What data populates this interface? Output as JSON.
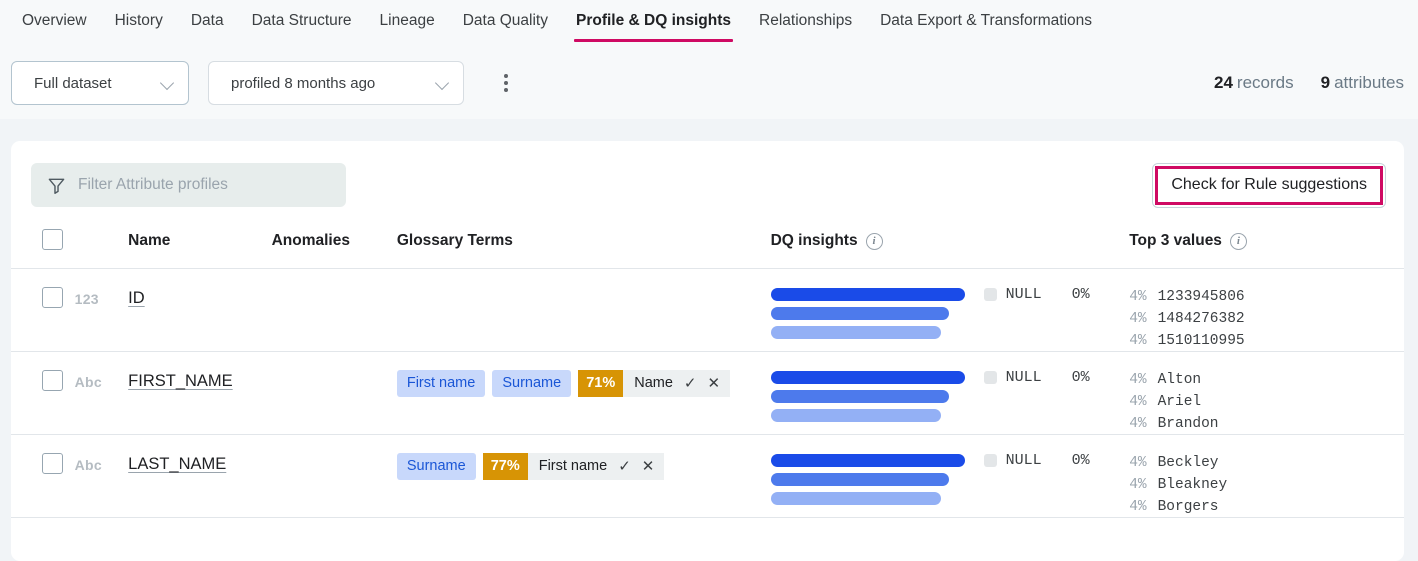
{
  "tabs": [
    {
      "label": "Overview",
      "active": false
    },
    {
      "label": "History",
      "active": false
    },
    {
      "label": "Data",
      "active": false
    },
    {
      "label": "Data Structure",
      "active": false
    },
    {
      "label": "Lineage",
      "active": false
    },
    {
      "label": "Data Quality",
      "active": false
    },
    {
      "label": "Profile & DQ insights",
      "active": true
    },
    {
      "label": "Relationships",
      "active": false
    },
    {
      "label": "Data Export & Transformations",
      "active": false
    }
  ],
  "toolbar": {
    "dataset_select": "Full dataset",
    "profiled_select": "profiled 8 months ago",
    "kebab_label": "more-options",
    "records_count": "24",
    "records_label": "records",
    "attributes_count": "9",
    "attributes_label": "attributes"
  },
  "card": {
    "filter_placeholder": "Filter Attribute profiles",
    "suggestions_button": "Check for Rule suggestions"
  },
  "table": {
    "headers": {
      "name": "Name",
      "anomalies": "Anomalies",
      "glossary": "Glossary Terms",
      "dq_insights": "DQ insights",
      "top_values": "Top 3 values"
    },
    "rows": [
      {
        "type_icon": "123",
        "name": "ID",
        "anomalies": "",
        "glossary_chips": [],
        "suggestion": null,
        "dq": {
          "bars": [
            100,
            92,
            88
          ],
          "null_label": "NULL",
          "null_pct": "0%"
        },
        "top_values": [
          {
            "pct": "4%",
            "value": "1233945806"
          },
          {
            "pct": "4%",
            "value": "1484276382"
          },
          {
            "pct": "4%",
            "value": "1510110995"
          }
        ]
      },
      {
        "type_icon": "Abc",
        "name": "FIRST_NAME",
        "anomalies": "",
        "glossary_chips": [
          "First name",
          "Surname"
        ],
        "suggestion": {
          "pct": "71%",
          "term": "Name",
          "accept": "✓",
          "reject": "✕"
        },
        "dq": {
          "bars": [
            100,
            92,
            88
          ],
          "null_label": "NULL",
          "null_pct": "0%"
        },
        "top_values": [
          {
            "pct": "4%",
            "value": "Alton"
          },
          {
            "pct": "4%",
            "value": "Ariel"
          },
          {
            "pct": "4%",
            "value": "Brandon"
          }
        ]
      },
      {
        "type_icon": "Abc",
        "name": "LAST_NAME",
        "anomalies": "",
        "glossary_chips": [
          "Surname"
        ],
        "suggestion": {
          "pct": "77%",
          "term": "First name",
          "accept": "✓",
          "reject": "✕"
        },
        "dq": {
          "bars": [
            100,
            92,
            88
          ],
          "null_label": "NULL",
          "null_pct": "0%"
        },
        "top_values": [
          {
            "pct": "4%",
            "value": "Beckley"
          },
          {
            "pct": "4%",
            "value": "Bleakney"
          },
          {
            "pct": "4%",
            "value": "Borgers"
          }
        ]
      }
    ]
  },
  "colors": {
    "accent_magenta": "#cf0a63",
    "bar_dark": "#1a4be8",
    "bar_mid": "#4d7aec",
    "bar_light": "#93b0f5",
    "chip_blue_bg": "#c8d8fb",
    "chip_blue_text": "#1a56d6",
    "suggestion_orange": "#d79405",
    "page_bg": "#f1f4f7"
  }
}
